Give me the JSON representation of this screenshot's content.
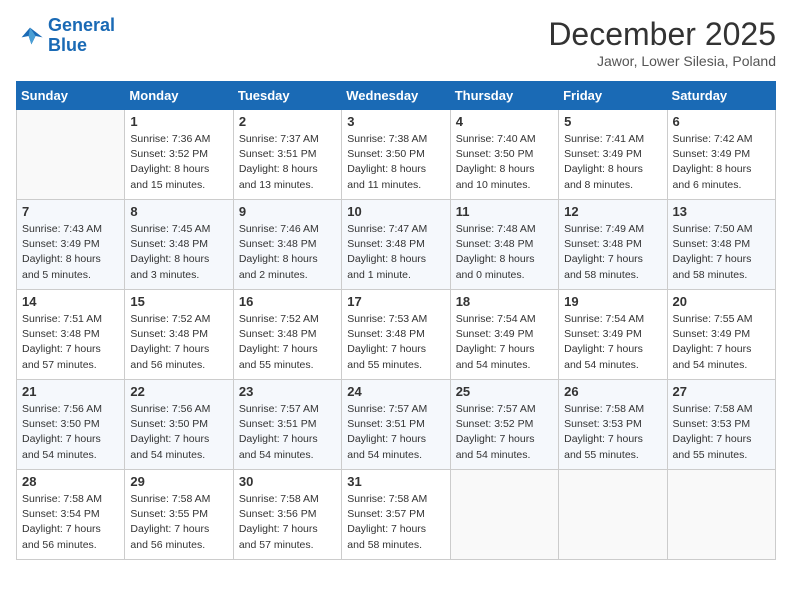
{
  "header": {
    "logo_line1": "General",
    "logo_line2": "Blue",
    "month_year": "December 2025",
    "location": "Jawor, Lower Silesia, Poland"
  },
  "weekdays": [
    "Sunday",
    "Monday",
    "Tuesday",
    "Wednesday",
    "Thursday",
    "Friday",
    "Saturday"
  ],
  "weeks": [
    [
      {
        "day": "",
        "info": ""
      },
      {
        "day": "1",
        "info": "Sunrise: 7:36 AM\nSunset: 3:52 PM\nDaylight: 8 hours\nand 15 minutes."
      },
      {
        "day": "2",
        "info": "Sunrise: 7:37 AM\nSunset: 3:51 PM\nDaylight: 8 hours\nand 13 minutes."
      },
      {
        "day": "3",
        "info": "Sunrise: 7:38 AM\nSunset: 3:50 PM\nDaylight: 8 hours\nand 11 minutes."
      },
      {
        "day": "4",
        "info": "Sunrise: 7:40 AM\nSunset: 3:50 PM\nDaylight: 8 hours\nand 10 minutes."
      },
      {
        "day": "5",
        "info": "Sunrise: 7:41 AM\nSunset: 3:49 PM\nDaylight: 8 hours\nand 8 minutes."
      },
      {
        "day": "6",
        "info": "Sunrise: 7:42 AM\nSunset: 3:49 PM\nDaylight: 8 hours\nand 6 minutes."
      }
    ],
    [
      {
        "day": "7",
        "info": "Sunrise: 7:43 AM\nSunset: 3:49 PM\nDaylight: 8 hours\nand 5 minutes."
      },
      {
        "day": "8",
        "info": "Sunrise: 7:45 AM\nSunset: 3:48 PM\nDaylight: 8 hours\nand 3 minutes."
      },
      {
        "day": "9",
        "info": "Sunrise: 7:46 AM\nSunset: 3:48 PM\nDaylight: 8 hours\nand 2 minutes."
      },
      {
        "day": "10",
        "info": "Sunrise: 7:47 AM\nSunset: 3:48 PM\nDaylight: 8 hours\nand 1 minute."
      },
      {
        "day": "11",
        "info": "Sunrise: 7:48 AM\nSunset: 3:48 PM\nDaylight: 8 hours\nand 0 minutes."
      },
      {
        "day": "12",
        "info": "Sunrise: 7:49 AM\nSunset: 3:48 PM\nDaylight: 7 hours\nand 58 minutes."
      },
      {
        "day": "13",
        "info": "Sunrise: 7:50 AM\nSunset: 3:48 PM\nDaylight: 7 hours\nand 58 minutes."
      }
    ],
    [
      {
        "day": "14",
        "info": "Sunrise: 7:51 AM\nSunset: 3:48 PM\nDaylight: 7 hours\nand 57 minutes."
      },
      {
        "day": "15",
        "info": "Sunrise: 7:52 AM\nSunset: 3:48 PM\nDaylight: 7 hours\nand 56 minutes."
      },
      {
        "day": "16",
        "info": "Sunrise: 7:52 AM\nSunset: 3:48 PM\nDaylight: 7 hours\nand 55 minutes."
      },
      {
        "day": "17",
        "info": "Sunrise: 7:53 AM\nSunset: 3:48 PM\nDaylight: 7 hours\nand 55 minutes."
      },
      {
        "day": "18",
        "info": "Sunrise: 7:54 AM\nSunset: 3:49 PM\nDaylight: 7 hours\nand 54 minutes."
      },
      {
        "day": "19",
        "info": "Sunrise: 7:54 AM\nSunset: 3:49 PM\nDaylight: 7 hours\nand 54 minutes."
      },
      {
        "day": "20",
        "info": "Sunrise: 7:55 AM\nSunset: 3:49 PM\nDaylight: 7 hours\nand 54 minutes."
      }
    ],
    [
      {
        "day": "21",
        "info": "Sunrise: 7:56 AM\nSunset: 3:50 PM\nDaylight: 7 hours\nand 54 minutes."
      },
      {
        "day": "22",
        "info": "Sunrise: 7:56 AM\nSunset: 3:50 PM\nDaylight: 7 hours\nand 54 minutes."
      },
      {
        "day": "23",
        "info": "Sunrise: 7:57 AM\nSunset: 3:51 PM\nDaylight: 7 hours\nand 54 minutes."
      },
      {
        "day": "24",
        "info": "Sunrise: 7:57 AM\nSunset: 3:51 PM\nDaylight: 7 hours\nand 54 minutes."
      },
      {
        "day": "25",
        "info": "Sunrise: 7:57 AM\nSunset: 3:52 PM\nDaylight: 7 hours\nand 54 minutes."
      },
      {
        "day": "26",
        "info": "Sunrise: 7:58 AM\nSunset: 3:53 PM\nDaylight: 7 hours\nand 55 minutes."
      },
      {
        "day": "27",
        "info": "Sunrise: 7:58 AM\nSunset: 3:53 PM\nDaylight: 7 hours\nand 55 minutes."
      }
    ],
    [
      {
        "day": "28",
        "info": "Sunrise: 7:58 AM\nSunset: 3:54 PM\nDaylight: 7 hours\nand 56 minutes."
      },
      {
        "day": "29",
        "info": "Sunrise: 7:58 AM\nSunset: 3:55 PM\nDaylight: 7 hours\nand 56 minutes."
      },
      {
        "day": "30",
        "info": "Sunrise: 7:58 AM\nSunset: 3:56 PM\nDaylight: 7 hours\nand 57 minutes."
      },
      {
        "day": "31",
        "info": "Sunrise: 7:58 AM\nSunset: 3:57 PM\nDaylight: 7 hours\nand 58 minutes."
      },
      {
        "day": "",
        "info": ""
      },
      {
        "day": "",
        "info": ""
      },
      {
        "day": "",
        "info": ""
      }
    ]
  ]
}
